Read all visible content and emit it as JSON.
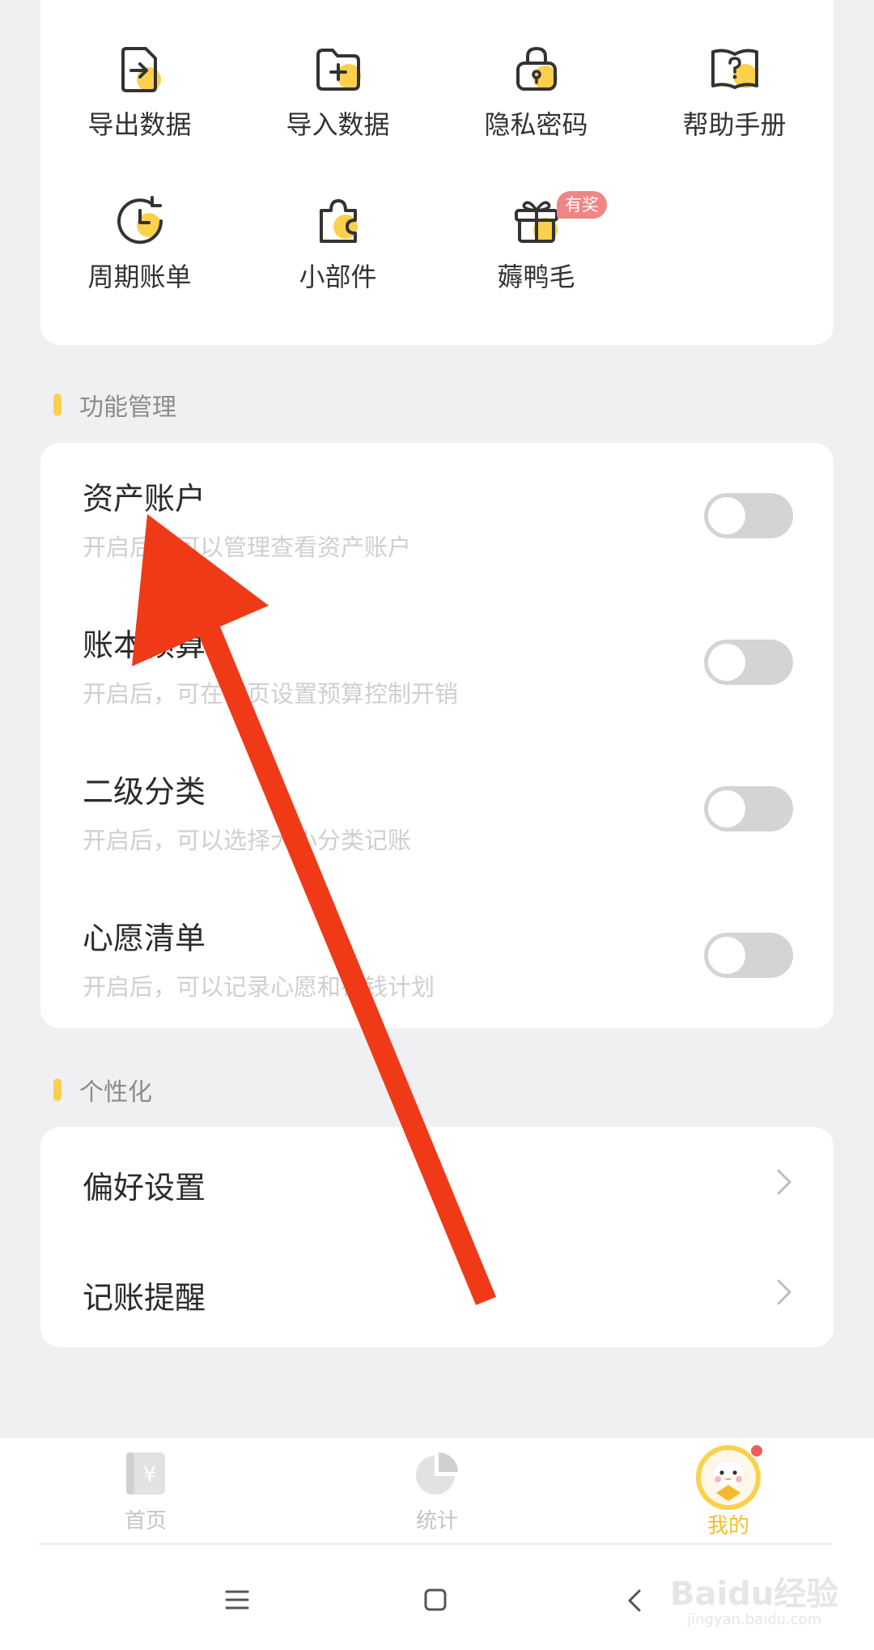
{
  "tools": [
    {
      "label": "导出数据",
      "icon": "export-file-icon"
    },
    {
      "label": "导入数据",
      "icon": "import-folder-icon"
    },
    {
      "label": "隐私密码",
      "icon": "lock-icon"
    },
    {
      "label": "帮助手册",
      "icon": "help-book-icon"
    },
    {
      "label": "周期账单",
      "icon": "clock-icon"
    },
    {
      "label": "小部件",
      "icon": "widget-puzzle-icon"
    },
    {
      "label": "薅鸭毛",
      "icon": "gift-icon",
      "badge": "有奖"
    }
  ],
  "sections": {
    "features_title": "功能管理",
    "personal_title": "个性化"
  },
  "features": [
    {
      "title": "资产账户",
      "desc": "开启后，可以管理查看资产账户",
      "enabled": false
    },
    {
      "title": "账本预算",
      "desc": "开启后，可在首页设置预算控制开销",
      "enabled": false
    },
    {
      "title": "二级分类",
      "desc": "开启后，可以选择大小分类记账",
      "enabled": false
    },
    {
      "title": "心愿清单",
      "desc": "开启后，可以记录心愿和存钱计划",
      "enabled": false
    }
  ],
  "personal": [
    {
      "title": "偏好设置"
    },
    {
      "title": "记账提醒"
    }
  ],
  "nav": {
    "home": "首页",
    "stats": "统计",
    "mine": "我的"
  },
  "watermark": {
    "line1": "Baidu经验",
    "line2": "jingyan.baidu.com"
  },
  "colors": {
    "accent": "#fbd04c",
    "active_tab": "#f0c02c",
    "annotation_arrow": "#f03a17",
    "badge": "#f08585"
  }
}
